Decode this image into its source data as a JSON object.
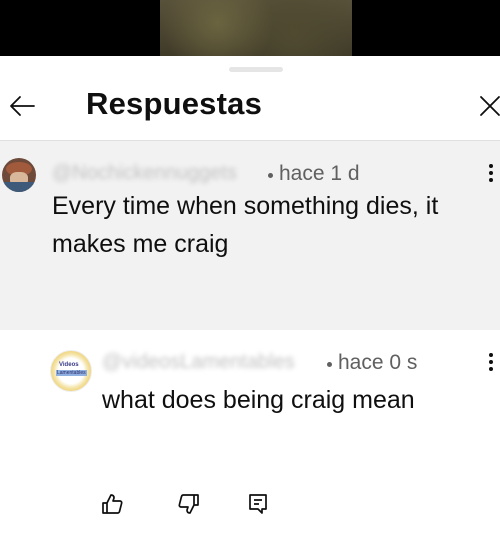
{
  "header": {
    "title": "Respuestas"
  },
  "comments": [
    {
      "username": "@Nochickennuggets",
      "time": "hace 1 d",
      "text_lines": [
        "Every time when something dies, it",
        "makes me craig"
      ]
    },
    {
      "username": "@videosLamentables",
      "time": "hace 0 s",
      "text_lines": [
        "what does being craig mean"
      ],
      "avatar_text": [
        "Videos",
        "Lamentables"
      ]
    }
  ],
  "icons": {
    "back": "arrow-left-icon",
    "close": "close-icon",
    "more": "more-vert-icon",
    "like": "thumb-up-icon",
    "dislike": "thumb-down-icon",
    "reply": "reply-comment-icon"
  },
  "colors": {
    "parent_bg": "#f2f2f2",
    "meta_text": "#606060",
    "primary_text": "#0f0f0f"
  }
}
